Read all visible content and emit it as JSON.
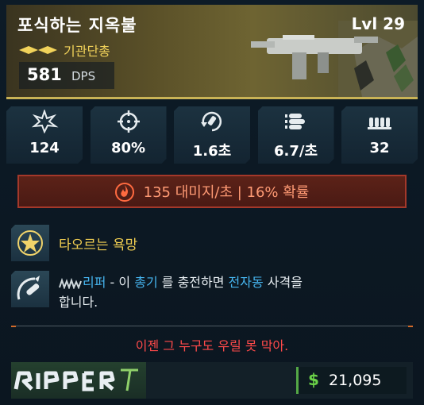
{
  "weapon": {
    "name": "포식하는 지옥불",
    "level": "Lvl 29",
    "type": "기관단총",
    "dps_value": "581",
    "dps_unit": "DPS"
  },
  "stats": [
    {
      "icon": "damage-burst-icon",
      "value": "124"
    },
    {
      "icon": "accuracy-crosshair-icon",
      "value": "80%"
    },
    {
      "icon": "reload-icon",
      "value": "1.6초"
    },
    {
      "icon": "fire-rate-bullets-icon",
      "value": "6.7/초"
    },
    {
      "icon": "magazine-ammo-icon",
      "value": "32"
    }
  ],
  "element": {
    "icon": "fire-icon",
    "text": "135 대미지/초 | 16% 확률",
    "color": "#ff9a74"
  },
  "perks": {
    "perk1": {
      "icon": "star-badge-icon",
      "text": "타오르는 욕망"
    },
    "perk2": {
      "icon": "charge-blade-icon",
      "brand": "리퍼",
      "part1": " - 이 ",
      "hl1": "총기",
      "part2": " 를 충전하면 ",
      "hl2": "전자동",
      "part3": " 사격을",
      "line2": "합니다."
    }
  },
  "flavor_text": "이젠 그 누구도 우릴 못 막아.",
  "footer": {
    "brand_logo": "ripper-logo",
    "price_symbol": "$",
    "price": "21,095"
  },
  "colors": {
    "rarity_gold": "#f2d35a",
    "highlight_blue": "#46b4ee",
    "flavor_red": "#ff4a4a",
    "price_green": "#6bd248"
  }
}
